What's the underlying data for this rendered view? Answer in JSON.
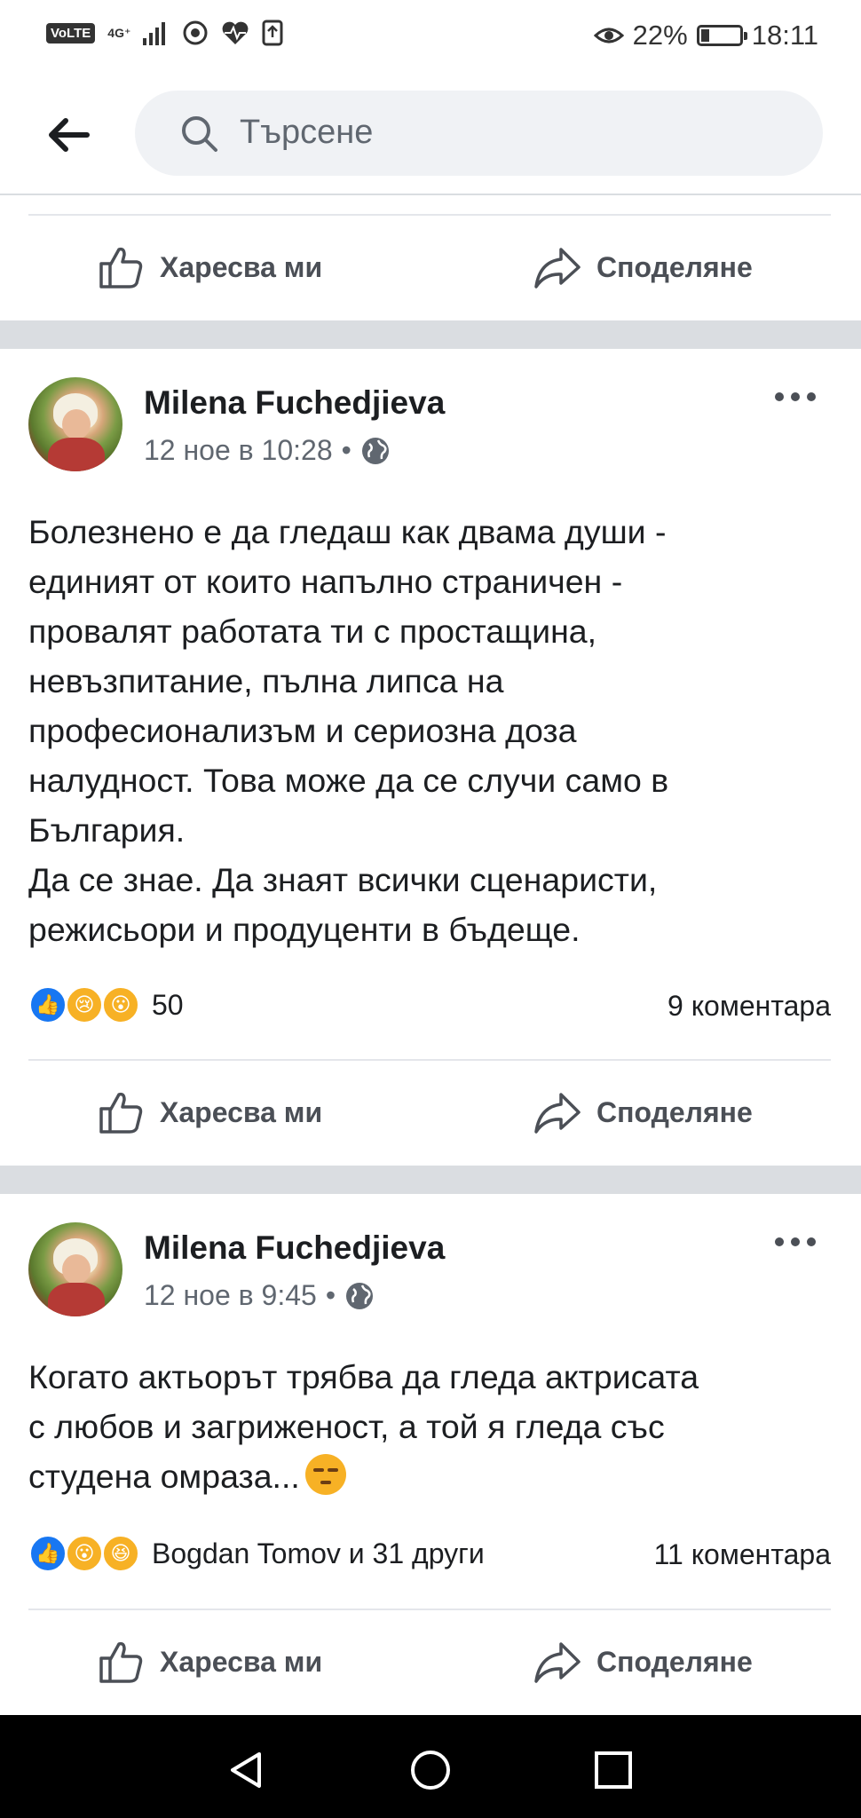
{
  "status_bar": {
    "network_badge": "VoLTE",
    "network_type": "4G⁺",
    "battery_percent": "22%",
    "battery_level": 0.22,
    "time": "18:11"
  },
  "search": {
    "placeholder": "Търсене"
  },
  "actions": {
    "like_label": "Харесва ми",
    "share_label": "Споделяне"
  },
  "posts": [
    {
      "author": "Milena Fuchedjieva",
      "timestamp": "12 ное в 10:28",
      "separator": "•",
      "text": "Болезнено е да гледаш как двама души -\nединият от които напълно страничен -\nпровалят работата ти с простащина,\nневъзпитание, пълна липса на\nпрофесионализъм и сериозна доза\nналудност. Това може да се случи само в\nБългария.\nДа се знае. Да знаят всички сценаристи,\nрежисьори и продуценти в бъдеще.",
      "reactions": [
        "like",
        "sad",
        "wow"
      ],
      "reaction_count": "50",
      "comments": "9 коментара"
    },
    {
      "author": "Milena Fuchedjieva",
      "timestamp": "12 ное в 9:45",
      "separator": "•",
      "text": "Когато актьорът трябва да гледа актрисата\nс любов и загриженост, а той я гледа със\nстудена омраза...",
      "text_emoji": "unamused-face",
      "reactions": [
        "like",
        "wow",
        "haha"
      ],
      "reaction_count": "Bogdan Tomov и 31 други",
      "comments": "11 коментара"
    }
  ],
  "colors": {
    "accent": "#1877f2",
    "separator": "#dadde1",
    "search_bg": "#f0f2f5",
    "nav_bar": "#000000"
  }
}
